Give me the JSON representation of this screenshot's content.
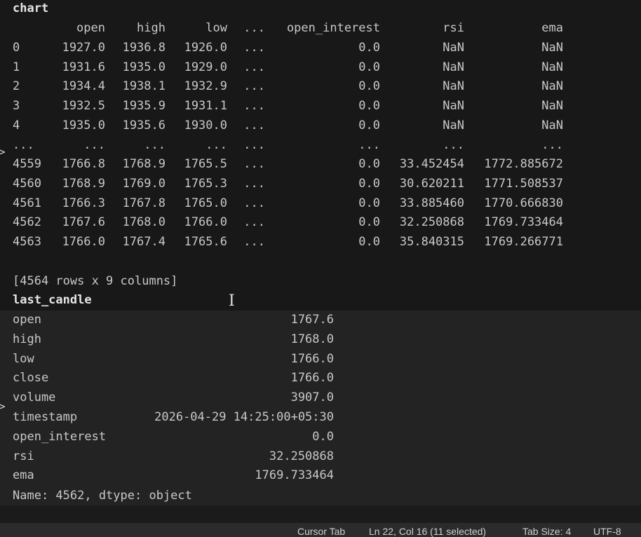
{
  "output": {
    "chart_label": "chart",
    "columns": [
      "open",
      "high",
      "low",
      "...",
      "open_interest",
      "rsi",
      "ema"
    ],
    "rows": [
      {
        "index": "0",
        "cells": [
          "1927.0",
          "1936.8",
          "1926.0",
          "...",
          "0.0",
          "NaN",
          "NaN"
        ]
      },
      {
        "index": "1",
        "cells": [
          "1931.6",
          "1935.0",
          "1929.0",
          "...",
          "0.0",
          "NaN",
          "NaN"
        ]
      },
      {
        "index": "2",
        "cells": [
          "1934.4",
          "1938.1",
          "1932.9",
          "...",
          "0.0",
          "NaN",
          "NaN"
        ]
      },
      {
        "index": "3",
        "cells": [
          "1932.5",
          "1935.9",
          "1931.1",
          "...",
          "0.0",
          "NaN",
          "NaN"
        ]
      },
      {
        "index": "4",
        "cells": [
          "1935.0",
          "1935.6",
          "1930.0",
          "...",
          "0.0",
          "NaN",
          "NaN"
        ]
      },
      {
        "index": "...",
        "cells": [
          "...",
          "...",
          "...",
          "...",
          "...",
          "...",
          "..."
        ]
      },
      {
        "index": "4559",
        "cells": [
          "1766.8",
          "1768.9",
          "1765.5",
          "...",
          "0.0",
          "33.452454",
          "1772.885672"
        ]
      },
      {
        "index": "4560",
        "cells": [
          "1768.9",
          "1769.0",
          "1765.3",
          "...",
          "0.0",
          "30.620211",
          "1771.508537"
        ]
      },
      {
        "index": "4561",
        "cells": [
          "1766.3",
          "1767.8",
          "1765.0",
          "...",
          "0.0",
          "33.885460",
          "1770.666830"
        ]
      },
      {
        "index": "4562",
        "cells": [
          "1767.6",
          "1768.0",
          "1766.0",
          "...",
          "0.0",
          "32.250868",
          "1769.733464"
        ]
      },
      {
        "index": "4563",
        "cells": [
          "1766.0",
          "1767.4",
          "1765.6",
          "...",
          "0.0",
          "35.840315",
          "1769.266771"
        ]
      }
    ],
    "shape_text": "[4564 rows x 9 columns]",
    "last_candle_label": "last_candle",
    "series": [
      {
        "key": "open",
        "value": "1767.6"
      },
      {
        "key": "high",
        "value": "1768.0"
      },
      {
        "key": "low",
        "value": "1766.0"
      },
      {
        "key": "close",
        "value": "1766.0"
      },
      {
        "key": "volume",
        "value": "3907.0"
      },
      {
        "key": "timestamp",
        "value": "2026-04-29 14:25:00+05:30"
      },
      {
        "key": "open_interest",
        "value": "0.0"
      },
      {
        "key": "rsi",
        "value": "32.250868"
      },
      {
        "key": "ema",
        "value": "1769.733464"
      }
    ],
    "series_footer": "Name: 4562, dtype: object",
    "gutter_marker": ">"
  },
  "status_bar": {
    "cursor_tab": "Cursor Tab",
    "position": "Ln 22, Col 16 (11 selected)",
    "tab_size": "Tab Size: 4",
    "encoding": "UTF-8"
  },
  "colors": {
    "top_bg": "#181818",
    "bottom_bg": "#232323",
    "status_bg": "#2b2b2b",
    "text": "#c8c8c8"
  }
}
